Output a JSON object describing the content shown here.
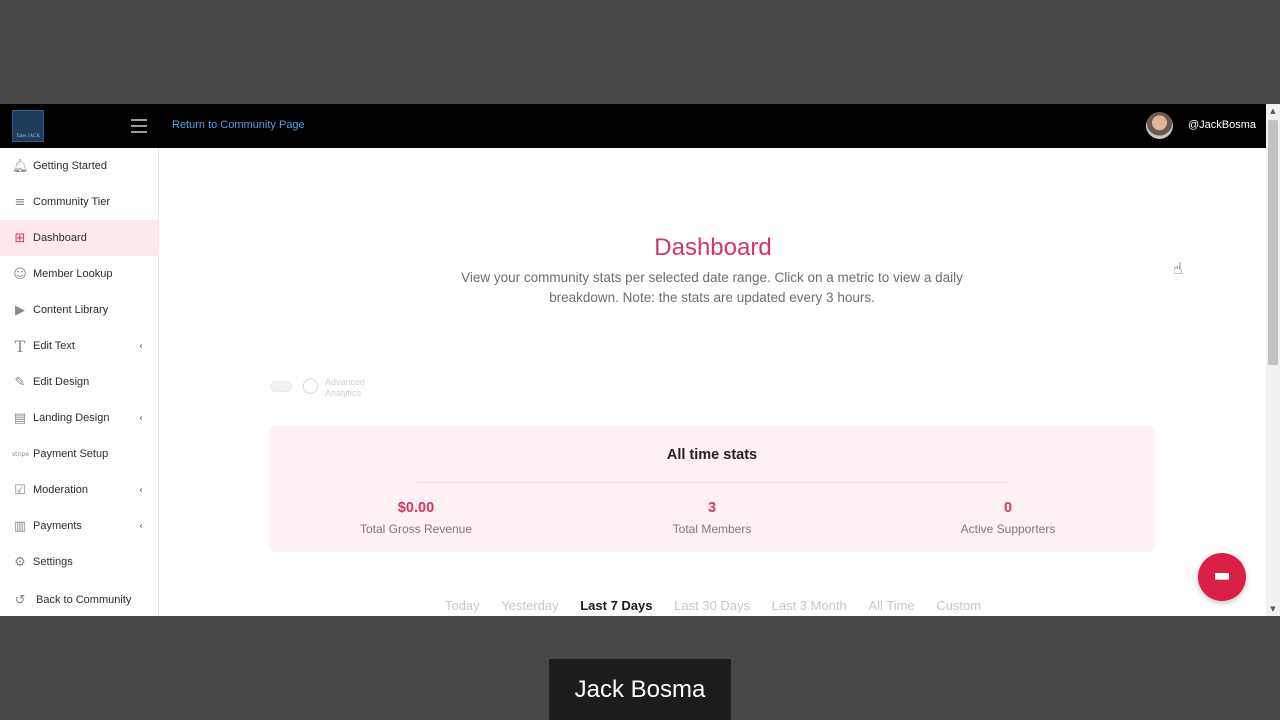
{
  "topbar": {
    "logo_text": "Tales JACK",
    "return_link": "Return to Community Page",
    "username": "@JackBosma"
  },
  "sidebar": {
    "items": [
      {
        "label": "Getting Started",
        "icon": "bell-icon"
      },
      {
        "label": "Community Tier",
        "icon": "tiers-icon"
      },
      {
        "label": "Dashboard",
        "icon": "grid-icon",
        "active": true
      },
      {
        "label": "Member Lookup",
        "icon": "users-icon"
      },
      {
        "label": "Content Library",
        "icon": "play-icon"
      },
      {
        "label": "Edit Text",
        "icon": "text-icon",
        "expandable": true
      },
      {
        "label": "Edit Design",
        "icon": "brush-icon"
      },
      {
        "label": "Landing Design",
        "icon": "layout-icon",
        "expandable": true
      },
      {
        "label": "Payment Setup",
        "icon": "stripe-icon"
      },
      {
        "label": "Moderation",
        "icon": "clipboard-icon",
        "expandable": true
      },
      {
        "label": "Payments",
        "icon": "document-icon",
        "expandable": true
      },
      {
        "label": "Settings",
        "icon": "gear-icon"
      },
      {
        "label": "Back to Community",
        "icon": "undo-icon"
      }
    ]
  },
  "main": {
    "title": "Dashboard",
    "subtitle": "View your community stats per selected date range. Click on a metric to view a daily breakdown. Note: the stats are updated every 3 hours.",
    "advanced_analytics_label": "Advanced Analytics",
    "all_time": {
      "title": "All time stats",
      "metrics": [
        {
          "value": "$0.00",
          "label": "Total Gross Revenue"
        },
        {
          "value": "3",
          "label": "Total Members"
        },
        {
          "value": "0",
          "label": "Active Supporters"
        }
      ]
    },
    "ranges": [
      "Today",
      "Yesterday",
      "Last 7 Days",
      "Last 30 Days",
      "Last 3 Month",
      "All Time",
      "Custom"
    ],
    "selected_range": "Last 7 Days"
  },
  "video": {
    "speaker_name": "Jack Bosma"
  },
  "colors": {
    "accent": "#d6365c",
    "active_bg": "#fde8ec",
    "card_bg": "#fef1f3",
    "chat_button": "#d81f45",
    "topbar": "#000000",
    "backdrop": "#474747"
  }
}
